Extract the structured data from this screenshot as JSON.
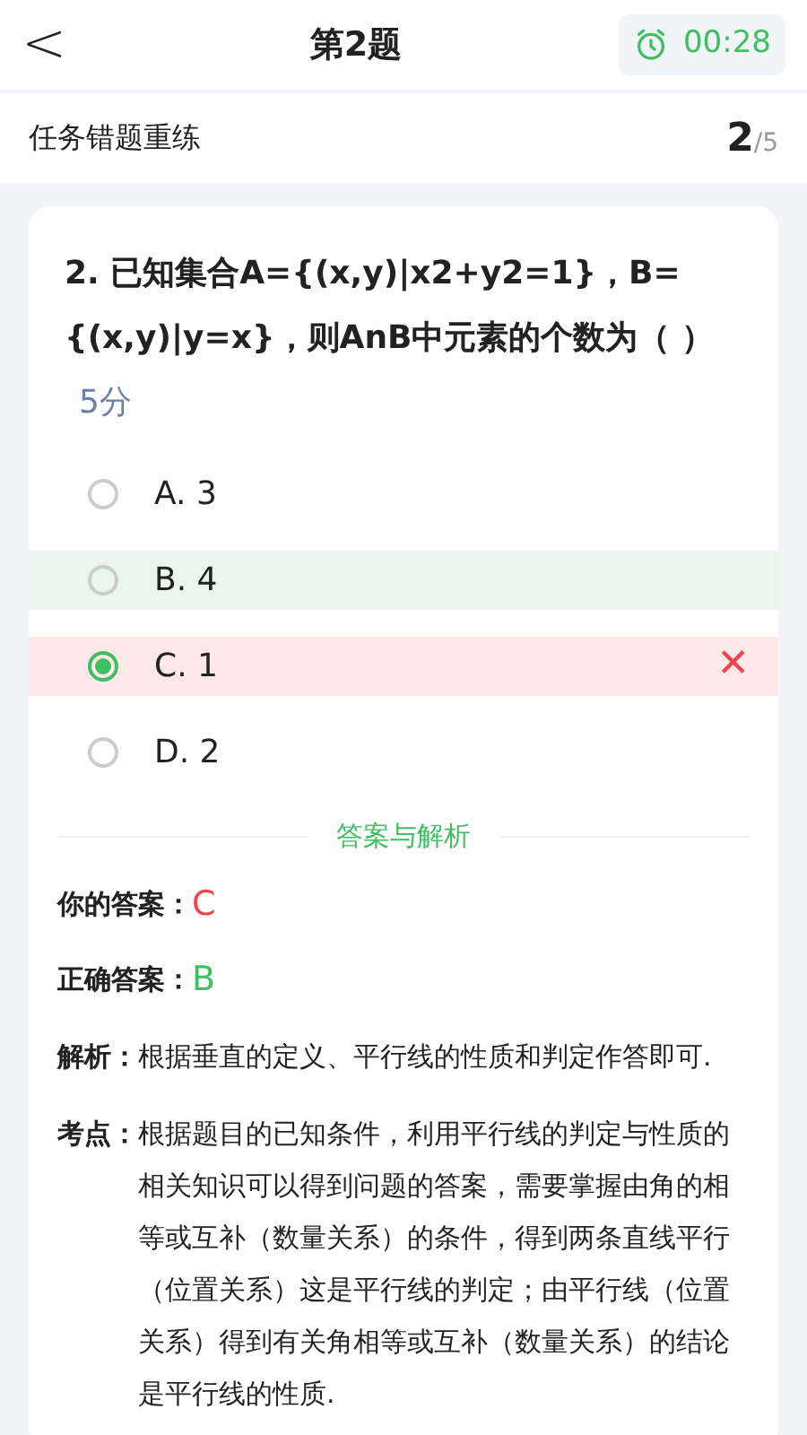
{
  "header": {
    "back": "<",
    "title": "第2题",
    "timer": "00:28"
  },
  "task": {
    "title": "任务错题重练",
    "current": "2",
    "total": "/5"
  },
  "question": {
    "text": "2. 已知集合A={(x,y)|x2+y2=1}，B={(x,y)|y=x}，则AnB中元素的个数为（  ）",
    "score": "5分"
  },
  "options": [
    {
      "label": "A. 3",
      "selected": false,
      "correct": false
    },
    {
      "label": "B. 4",
      "selected": false,
      "correct": true
    },
    {
      "label": "C. 1",
      "selected": true,
      "correct": false
    },
    {
      "label": "D. 2",
      "selected": false,
      "correct": false
    }
  ],
  "wrong_mark": "✕",
  "section_title": "答案与解析",
  "answers": [
    {
      "label": "你的答案：",
      "value": "C",
      "color": "#f0454f"
    },
    {
      "label": "正确答案：",
      "value": "B",
      "color": "#3fbf62"
    }
  ],
  "notes": [
    {
      "label": "解析：",
      "text": "根据垂直的定义、平行线的性质和判定作答即可."
    },
    {
      "label": "考点：",
      "text": "根据题目的已知条件，利用平行线的判定与性质的相关知识可以得到问题的答案，需要掌握由角的相等或互补（数量关系）的条件，得到两条直线平行（位置关系）这是平行线的判定；由平行线（位置关系）得到有关角相等或互补（数量关系）的结论是平行线的性质."
    }
  ]
}
